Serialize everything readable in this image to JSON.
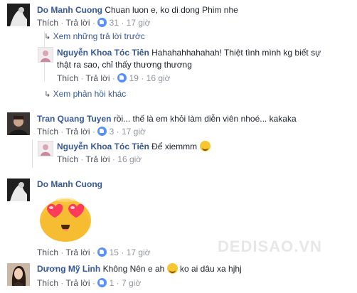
{
  "comments": [
    {
      "name": "Do Manh Cuong",
      "text": "Chuan luon e, ko di dong Phim nhe",
      "actions": {
        "like": "Thích",
        "reply": "Trả lời",
        "likes": "31",
        "time": "17 giờ"
      },
      "view_previous_replies": "Xem những trả lời trước",
      "reply": {
        "name": "Nguyễn Khoa Tóc Tiên",
        "text_line1": "Hahahahhahahah! Thiệt tình mình kg biết sự",
        "text_line2": "thật ra sao, chỉ thấy thương thương",
        "actions": {
          "like": "Thích",
          "reply": "Trả lời",
          "likes": "19",
          "time": "16 giờ"
        }
      },
      "view_more_replies": "Xem phản hồi khác"
    },
    {
      "name": "Tran Quang Tuyen",
      "text": "rồi... thế là em khỏi làm diễn viên nhoé... kakaka",
      "actions": {
        "like": "Thích",
        "reply": "Trả lời",
        "likes": "3",
        "time": "17 giờ"
      },
      "reply": {
        "name": "Nguyễn Khoa Tóc Tiên",
        "text": "Để xiemmm",
        "actions": {
          "like": "Thích",
          "reply": "Trả lời",
          "time": "16 giờ"
        }
      }
    },
    {
      "name": "Do Manh Cuong",
      "sticker": "heart-eyes-emoji",
      "actions": {
        "like": "Thích",
        "reply": "Trả lời",
        "likes": "15",
        "time": "17 giờ"
      }
    },
    {
      "name": "Dương Mỹ Linh",
      "text": "Không Nên e ah",
      "text_after_emoji": "ko ai dâu xa hjhj",
      "actions": {
        "like": "Thích",
        "reply": "Trả lời",
        "likes": "1",
        "time": "7 giờ"
      }
    }
  ],
  "watermark": "DEDISAO.VN",
  "colors": {
    "name": "#365899",
    "meta": "#90949c",
    "like": "#5890ff"
  },
  "separator": "·"
}
